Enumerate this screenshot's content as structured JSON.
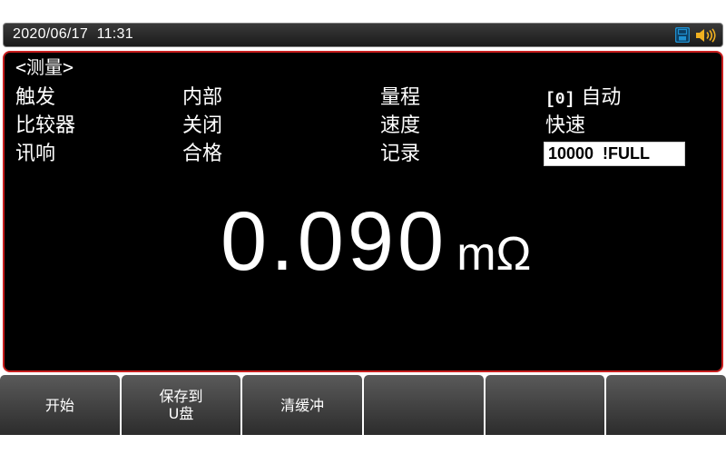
{
  "status_bar": {
    "datetime": "2020/06/17  11:31",
    "icons": [
      "usb-disk-icon",
      "speaker-sound-icon"
    ],
    "accent_color": "#1e90d0"
  },
  "panel": {
    "title": "<测量>",
    "border_color": "#c81e1e",
    "rows": [
      {
        "label_a": "触发",
        "value_a": "内部",
        "label_b": "量程",
        "value_b_code": "[0]",
        "value_b": "自动"
      },
      {
        "label_a": "比较器",
        "value_a": "关闭",
        "label_b": "速度",
        "value_b": "快速"
      },
      {
        "label_a": "讯响",
        "value_a": "合格",
        "label_b": "记录",
        "value_b": "10000  !FULL"
      }
    ]
  },
  "reading": {
    "value": "0.090",
    "unit": "mΩ"
  },
  "softkeys": [
    {
      "label": "开始"
    },
    {
      "label": "保存到\nU盘"
    },
    {
      "label": "清缓冲"
    },
    {
      "label": ""
    },
    {
      "label": ""
    },
    {
      "label": ""
    }
  ]
}
